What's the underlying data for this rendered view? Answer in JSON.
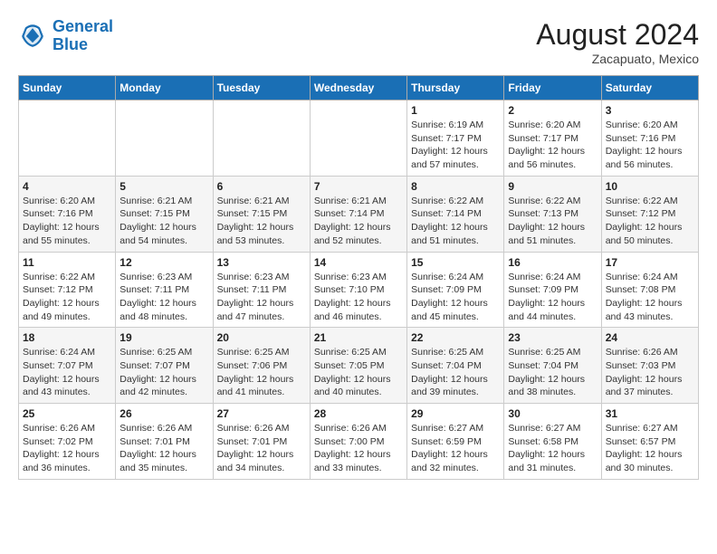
{
  "header": {
    "logo_line1": "General",
    "logo_line2": "Blue",
    "month_year": "August 2024",
    "location": "Zacapuato, Mexico"
  },
  "days_of_week": [
    "Sunday",
    "Monday",
    "Tuesday",
    "Wednesday",
    "Thursday",
    "Friday",
    "Saturday"
  ],
  "weeks": [
    [
      {
        "day": "",
        "detail": ""
      },
      {
        "day": "",
        "detail": ""
      },
      {
        "day": "",
        "detail": ""
      },
      {
        "day": "",
        "detail": ""
      },
      {
        "day": "1",
        "detail": "Sunrise: 6:19 AM\nSunset: 7:17 PM\nDaylight: 12 hours\nand 57 minutes."
      },
      {
        "day": "2",
        "detail": "Sunrise: 6:20 AM\nSunset: 7:17 PM\nDaylight: 12 hours\nand 56 minutes."
      },
      {
        "day": "3",
        "detail": "Sunrise: 6:20 AM\nSunset: 7:16 PM\nDaylight: 12 hours\nand 56 minutes."
      }
    ],
    [
      {
        "day": "4",
        "detail": "Sunrise: 6:20 AM\nSunset: 7:16 PM\nDaylight: 12 hours\nand 55 minutes."
      },
      {
        "day": "5",
        "detail": "Sunrise: 6:21 AM\nSunset: 7:15 PM\nDaylight: 12 hours\nand 54 minutes."
      },
      {
        "day": "6",
        "detail": "Sunrise: 6:21 AM\nSunset: 7:15 PM\nDaylight: 12 hours\nand 53 minutes."
      },
      {
        "day": "7",
        "detail": "Sunrise: 6:21 AM\nSunset: 7:14 PM\nDaylight: 12 hours\nand 52 minutes."
      },
      {
        "day": "8",
        "detail": "Sunrise: 6:22 AM\nSunset: 7:14 PM\nDaylight: 12 hours\nand 51 minutes."
      },
      {
        "day": "9",
        "detail": "Sunrise: 6:22 AM\nSunset: 7:13 PM\nDaylight: 12 hours\nand 51 minutes."
      },
      {
        "day": "10",
        "detail": "Sunrise: 6:22 AM\nSunset: 7:12 PM\nDaylight: 12 hours\nand 50 minutes."
      }
    ],
    [
      {
        "day": "11",
        "detail": "Sunrise: 6:22 AM\nSunset: 7:12 PM\nDaylight: 12 hours\nand 49 minutes."
      },
      {
        "day": "12",
        "detail": "Sunrise: 6:23 AM\nSunset: 7:11 PM\nDaylight: 12 hours\nand 48 minutes."
      },
      {
        "day": "13",
        "detail": "Sunrise: 6:23 AM\nSunset: 7:11 PM\nDaylight: 12 hours\nand 47 minutes."
      },
      {
        "day": "14",
        "detail": "Sunrise: 6:23 AM\nSunset: 7:10 PM\nDaylight: 12 hours\nand 46 minutes."
      },
      {
        "day": "15",
        "detail": "Sunrise: 6:24 AM\nSunset: 7:09 PM\nDaylight: 12 hours\nand 45 minutes."
      },
      {
        "day": "16",
        "detail": "Sunrise: 6:24 AM\nSunset: 7:09 PM\nDaylight: 12 hours\nand 44 minutes."
      },
      {
        "day": "17",
        "detail": "Sunrise: 6:24 AM\nSunset: 7:08 PM\nDaylight: 12 hours\nand 43 minutes."
      }
    ],
    [
      {
        "day": "18",
        "detail": "Sunrise: 6:24 AM\nSunset: 7:07 PM\nDaylight: 12 hours\nand 43 minutes."
      },
      {
        "day": "19",
        "detail": "Sunrise: 6:25 AM\nSunset: 7:07 PM\nDaylight: 12 hours\nand 42 minutes."
      },
      {
        "day": "20",
        "detail": "Sunrise: 6:25 AM\nSunset: 7:06 PM\nDaylight: 12 hours\nand 41 minutes."
      },
      {
        "day": "21",
        "detail": "Sunrise: 6:25 AM\nSunset: 7:05 PM\nDaylight: 12 hours\nand 40 minutes."
      },
      {
        "day": "22",
        "detail": "Sunrise: 6:25 AM\nSunset: 7:04 PM\nDaylight: 12 hours\nand 39 minutes."
      },
      {
        "day": "23",
        "detail": "Sunrise: 6:25 AM\nSunset: 7:04 PM\nDaylight: 12 hours\nand 38 minutes."
      },
      {
        "day": "24",
        "detail": "Sunrise: 6:26 AM\nSunset: 7:03 PM\nDaylight: 12 hours\nand 37 minutes."
      }
    ],
    [
      {
        "day": "25",
        "detail": "Sunrise: 6:26 AM\nSunset: 7:02 PM\nDaylight: 12 hours\nand 36 minutes."
      },
      {
        "day": "26",
        "detail": "Sunrise: 6:26 AM\nSunset: 7:01 PM\nDaylight: 12 hours\nand 35 minutes."
      },
      {
        "day": "27",
        "detail": "Sunrise: 6:26 AM\nSunset: 7:01 PM\nDaylight: 12 hours\nand 34 minutes."
      },
      {
        "day": "28",
        "detail": "Sunrise: 6:26 AM\nSunset: 7:00 PM\nDaylight: 12 hours\nand 33 minutes."
      },
      {
        "day": "29",
        "detail": "Sunrise: 6:27 AM\nSunset: 6:59 PM\nDaylight: 12 hours\nand 32 minutes."
      },
      {
        "day": "30",
        "detail": "Sunrise: 6:27 AM\nSunset: 6:58 PM\nDaylight: 12 hours\nand 31 minutes."
      },
      {
        "day": "31",
        "detail": "Sunrise: 6:27 AM\nSunset: 6:57 PM\nDaylight: 12 hours\nand 30 minutes."
      }
    ]
  ]
}
